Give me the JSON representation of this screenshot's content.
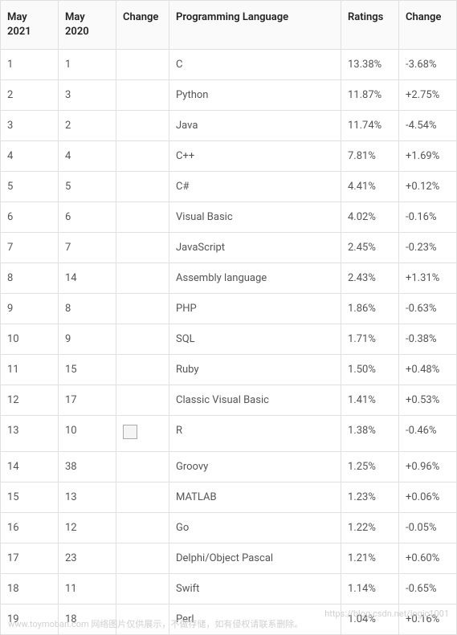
{
  "chart_data": {
    "type": "table",
    "title": "",
    "columns": [
      "May 2021",
      "May 2020",
      "Change",
      "Programming Language",
      "Ratings",
      "Change"
    ],
    "rows": [
      {
        "may2021": "1",
        "may2020": "1",
        "change1": "",
        "language": "C",
        "ratings": "13.38%",
        "change2": "-3.68%"
      },
      {
        "may2021": "2",
        "may2020": "3",
        "change1": "",
        "language": "Python",
        "ratings": "11.87%",
        "change2": "+2.75%"
      },
      {
        "may2021": "3",
        "may2020": "2",
        "change1": "",
        "language": "Java",
        "ratings": "11.74%",
        "change2": "-4.54%"
      },
      {
        "may2021": "4",
        "may2020": "4",
        "change1": "",
        "language": "C++",
        "ratings": "7.81%",
        "change2": "+1.69%"
      },
      {
        "may2021": "5",
        "may2020": "5",
        "change1": "",
        "language": "C#",
        "ratings": "4.41%",
        "change2": "+0.12%"
      },
      {
        "may2021": "6",
        "may2020": "6",
        "change1": "",
        "language": "Visual Basic",
        "ratings": "4.02%",
        "change2": "-0.16%"
      },
      {
        "may2021": "7",
        "may2020": "7",
        "change1": "",
        "language": "JavaScript",
        "ratings": "2.45%",
        "change2": "-0.23%"
      },
      {
        "may2021": "8",
        "may2020": "14",
        "change1": "",
        "language": "Assembly language",
        "ratings": "2.43%",
        "change2": "+1.31%"
      },
      {
        "may2021": "9",
        "may2020": "8",
        "change1": "",
        "language": "PHP",
        "ratings": "1.86%",
        "change2": "-0.63%"
      },
      {
        "may2021": "10",
        "may2020": "9",
        "change1": "",
        "language": "SQL",
        "ratings": "1.71%",
        "change2": "-0.38%"
      },
      {
        "may2021": "11",
        "may2020": "15",
        "change1": "",
        "language": "Ruby",
        "ratings": "1.50%",
        "change2": "+0.48%"
      },
      {
        "may2021": "12",
        "may2020": "17",
        "change1": "",
        "language": "Classic Visual Basic",
        "ratings": "1.41%",
        "change2": "+0.53%"
      },
      {
        "may2021": "13",
        "may2020": "10",
        "change1": "icon",
        "language": "R",
        "ratings": "1.38%",
        "change2": "-0.46%"
      },
      {
        "may2021": "14",
        "may2020": "38",
        "change1": "",
        "language": "Groovy",
        "ratings": "1.25%",
        "change2": "+0.96%"
      },
      {
        "may2021": "15",
        "may2020": "13",
        "change1": "",
        "language": "MATLAB",
        "ratings": "1.23%",
        "change2": "+0.06%"
      },
      {
        "may2021": "16",
        "may2020": "12",
        "change1": "",
        "language": "Go",
        "ratings": "1.22%",
        "change2": "-0.05%"
      },
      {
        "may2021": "17",
        "may2020": "23",
        "change1": "",
        "language": "Delphi/Object Pascal",
        "ratings": "1.21%",
        "change2": "+0.60%"
      },
      {
        "may2021": "18",
        "may2020": "11",
        "change1": "",
        "language": "Swift",
        "ratings": "1.14%",
        "change2": "-0.65%"
      },
      {
        "may2021": "19",
        "may2020": "18",
        "change1": "",
        "language": "Perl",
        "ratings": "1.04%",
        "change2": "+0.16%"
      }
    ]
  },
  "headers": {
    "may2021": "May 2021",
    "may2020": "May 2020",
    "change1": "Change",
    "language": "Programming Language",
    "ratings": "Ratings",
    "change2": "Change"
  },
  "watermark": {
    "left": "www.toymoban.com 网络图片仅供展示，不做存储，如有侵权请联系删除。",
    "right": "https://blog.csdn.net/logic1001"
  }
}
